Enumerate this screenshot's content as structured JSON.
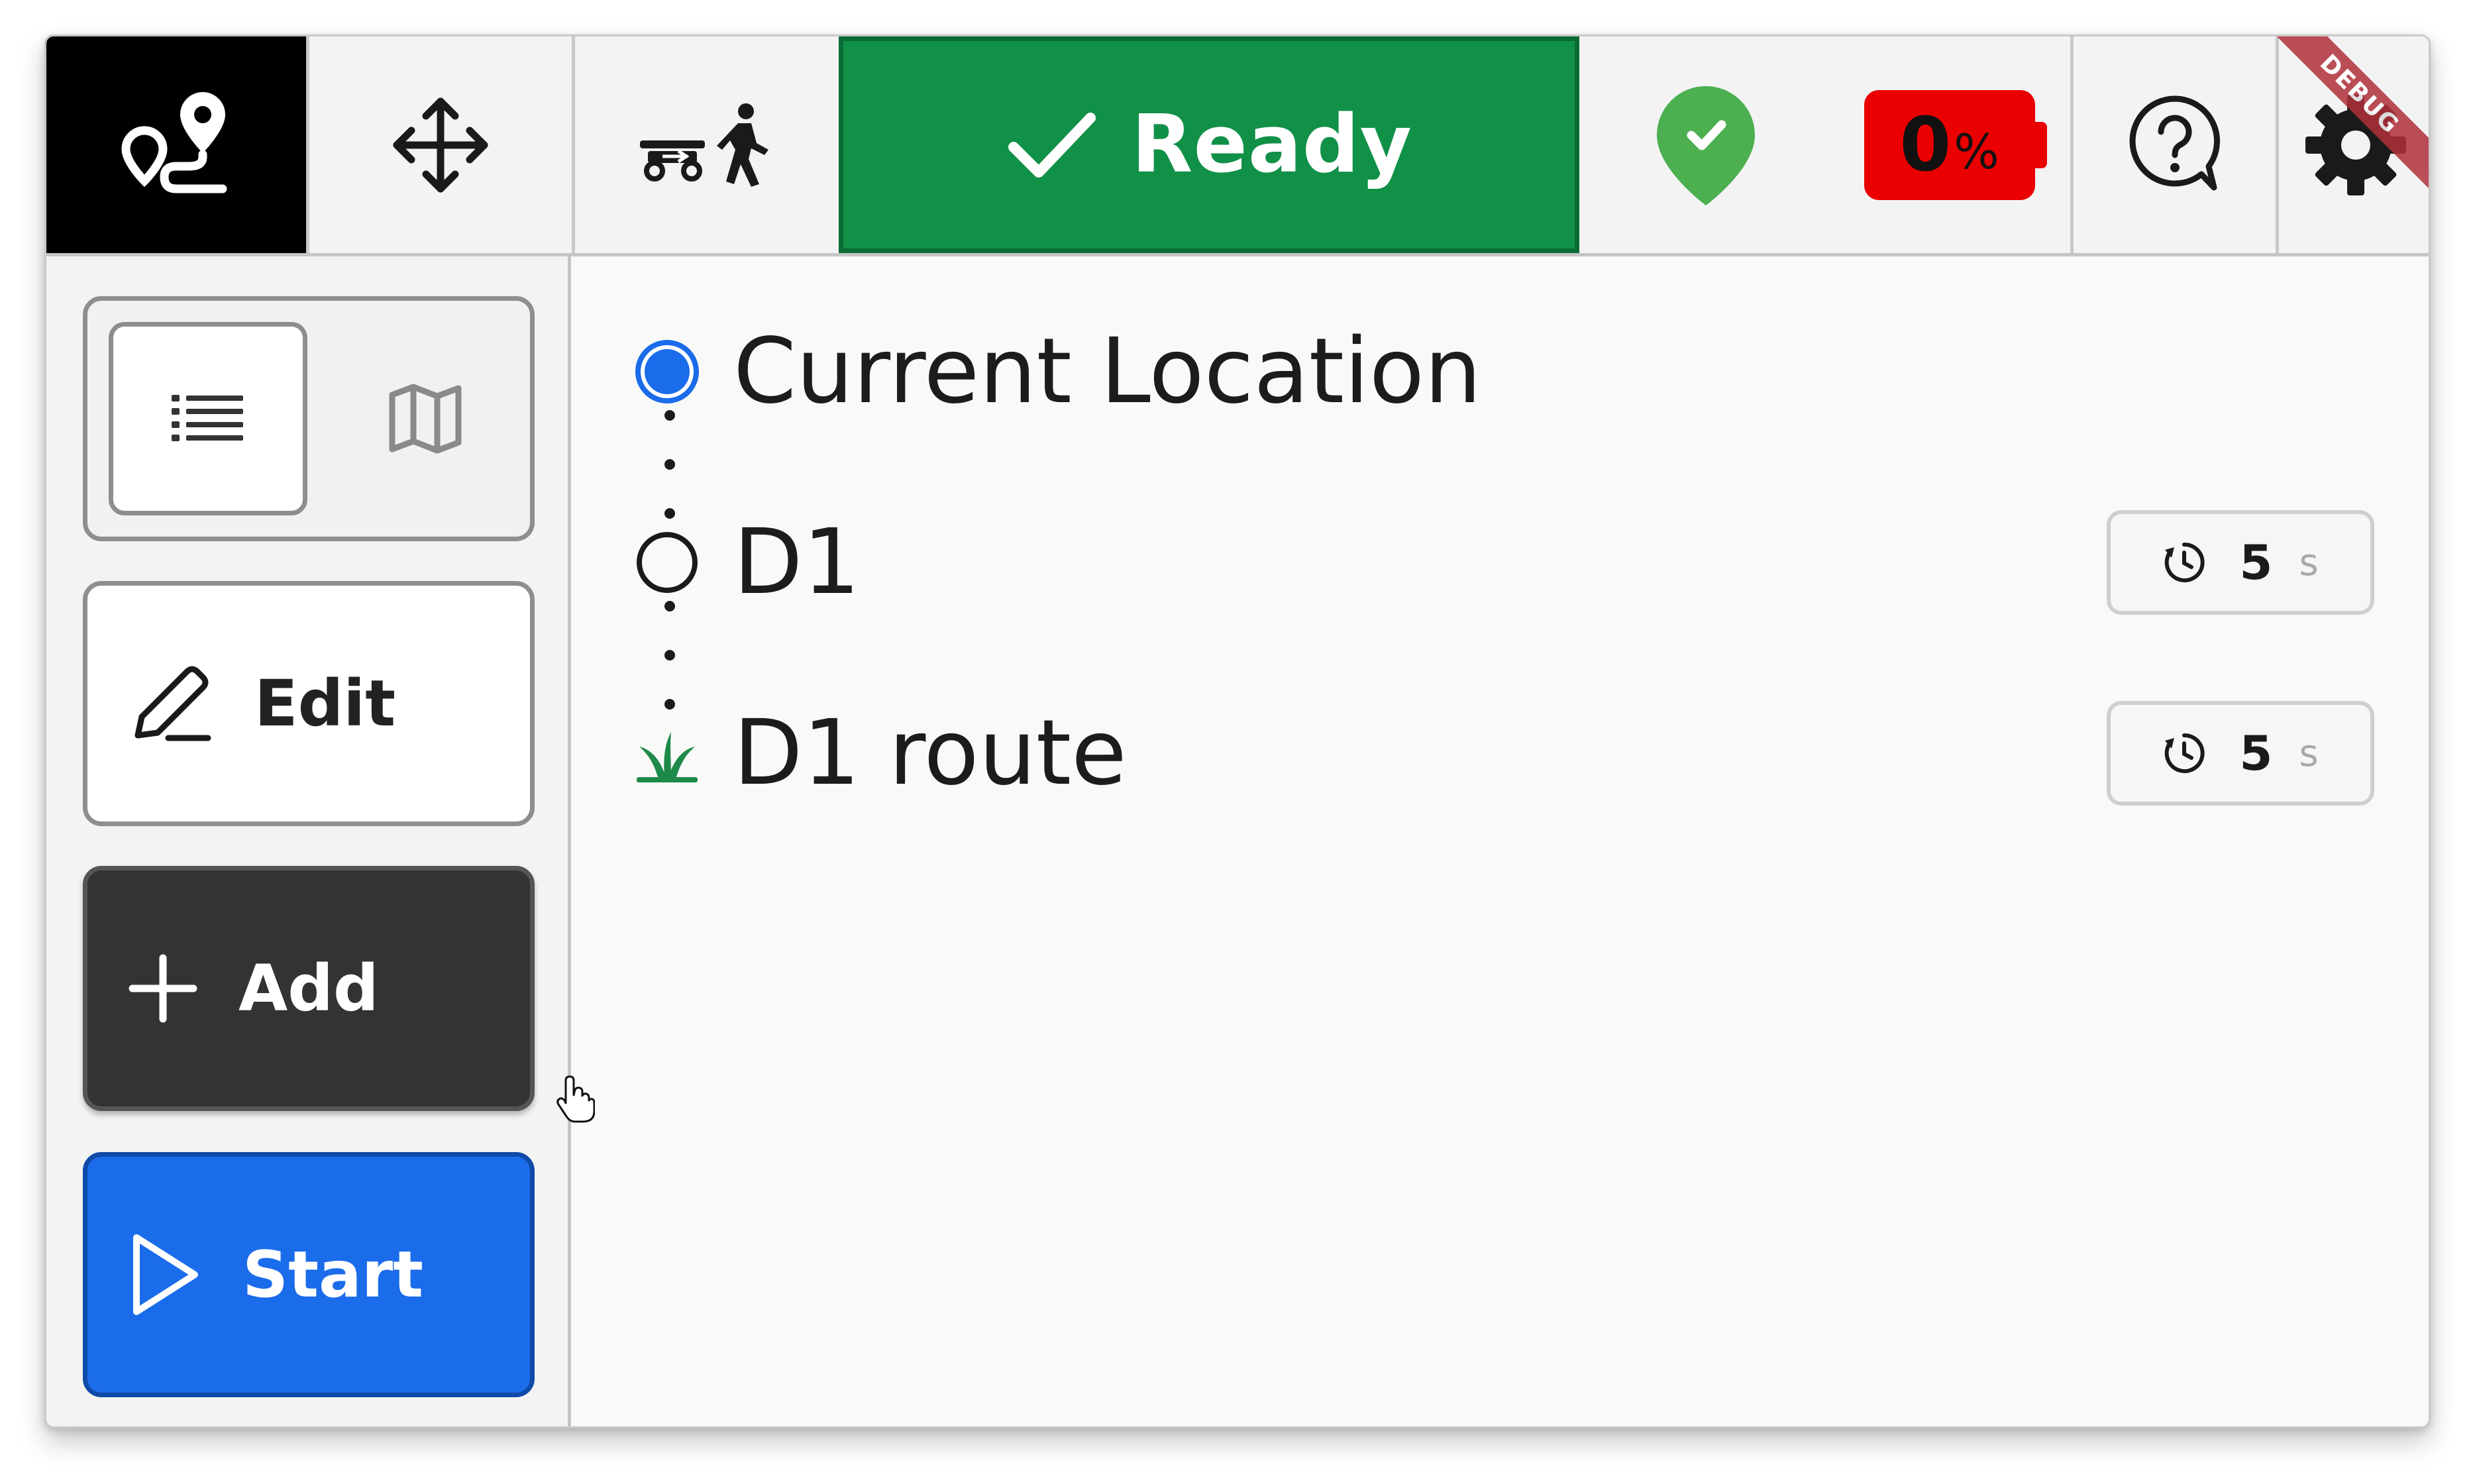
{
  "toolbar": {
    "logo_icon": "route-pin-icon",
    "move_icon": "move-arrows-icon",
    "follow_icon": "robot-follow-person-icon",
    "status": {
      "label": "Ready",
      "icon": "check-icon",
      "color": "#119048"
    },
    "gps_icon": "location-ok-pin-icon",
    "battery": {
      "value": "0",
      "unit": "%",
      "color": "#ea0000"
    },
    "help_icon": "help-bubble-icon",
    "settings_icon": "gear-icon",
    "debug_label": "DEBUG"
  },
  "sidebar": {
    "view_toggle": {
      "selected": "list",
      "options": [
        "list-icon",
        "map-icon"
      ]
    },
    "edit_label": "Edit",
    "add_label": "Add",
    "start_label": "Start"
  },
  "route": {
    "items": [
      {
        "name": "Current Location",
        "marker": "current-location",
        "wait": null
      },
      {
        "name": "D1",
        "marker": "waypoint",
        "wait": {
          "value": "5",
          "unit": "s"
        }
      },
      {
        "name": "D1 route",
        "marker": "plant",
        "wait": {
          "value": "5",
          "unit": "s"
        }
      }
    ]
  },
  "colors": {
    "accent_blue": "#1b6cea",
    "ready_green": "#119048",
    "battery_red": "#ea0000",
    "plant_green": "#1e8a4a"
  }
}
